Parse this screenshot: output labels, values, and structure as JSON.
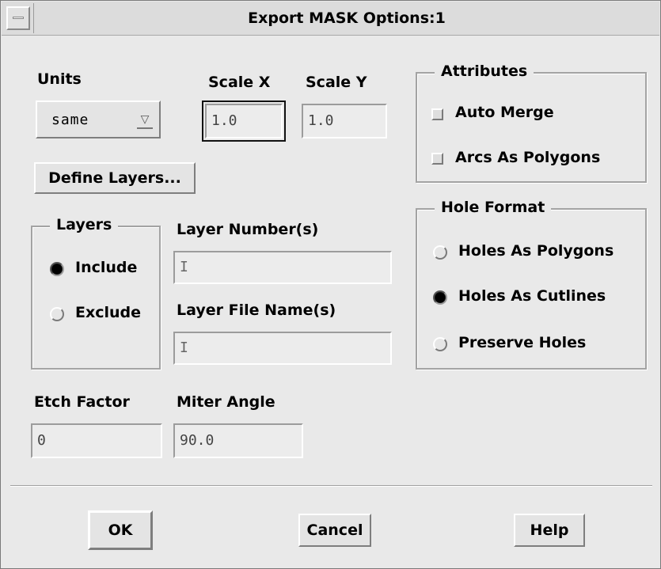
{
  "window": {
    "title": "Export MASK Options:1"
  },
  "units": {
    "label": "Units",
    "selected": "same",
    "arrow": "▽"
  },
  "scale": {
    "x_label": "Scale X",
    "x_value": "1.0",
    "y_label": "Scale Y",
    "y_value": "1.0"
  },
  "define_layers_label": "Define Layers...",
  "attributes": {
    "legend": "Attributes",
    "auto_merge": "Auto Merge",
    "arcs_as_polygons": "Arcs As Polygons"
  },
  "layers": {
    "legend": "Layers",
    "include": "Include",
    "exclude": "Exclude",
    "selected": "Include"
  },
  "layer_numbers": {
    "label": "Layer Number(s)",
    "value": ""
  },
  "layer_file_names": {
    "label": "Layer File Name(s)",
    "value": ""
  },
  "hole_format": {
    "legend": "Hole Format",
    "holes_as_polygons": "Holes As Polygons",
    "holes_as_cutlines": "Holes As Cutlines",
    "preserve_holes": "Preserve Holes",
    "selected": "Holes As Cutlines"
  },
  "etch_factor": {
    "label": "Etch Factor",
    "value": "0"
  },
  "miter_angle": {
    "label": "Miter Angle",
    "value": "90.0"
  },
  "buttons": {
    "ok": "OK",
    "cancel": "Cancel",
    "help": "Help"
  },
  "caret_glyph": "I",
  "icons": {
    "window_menu": "window-menu-icon"
  }
}
